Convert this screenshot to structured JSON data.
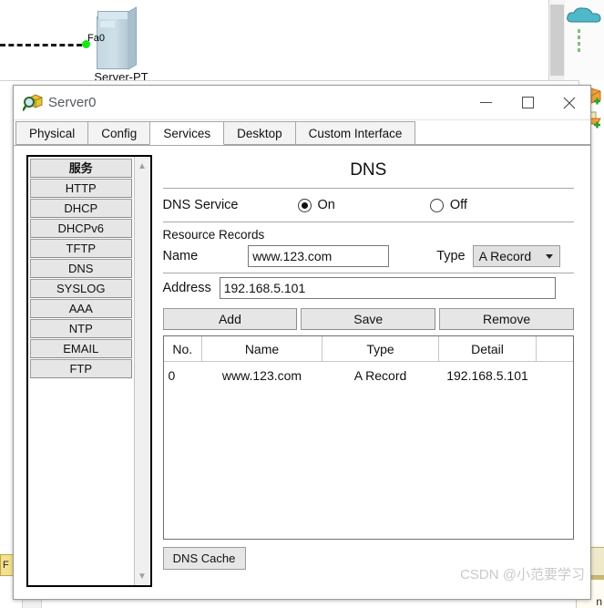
{
  "workspace": {
    "device_port_label": "Fa0",
    "device_name": "Server-PT"
  },
  "dialog": {
    "title": "Server0",
    "icon": "magnifier-package-icon",
    "window_buttons": {
      "minimize": "minimize-icon",
      "maximize": "maximize-icon",
      "close": "close-icon"
    },
    "tabs": [
      {
        "label": "Physical",
        "active": false
      },
      {
        "label": "Config",
        "active": false
      },
      {
        "label": "Services",
        "active": true
      },
      {
        "label": "Desktop",
        "active": false
      },
      {
        "label": "Custom Interface",
        "active": false
      }
    ]
  },
  "services_list": {
    "header": "服务",
    "items": [
      "HTTP",
      "DHCP",
      "DHCPv6",
      "TFTP",
      "DNS",
      "SYSLOG",
      "AAA",
      "NTP",
      "EMAIL",
      "FTP"
    ],
    "scroll_up": "chevron-up-icon",
    "scroll_down": "chevron-down-icon"
  },
  "dns_panel": {
    "title": "DNS",
    "service_label": "DNS Service",
    "radio_on": "On",
    "radio_off": "Off",
    "service_state": "On",
    "resource_records_label": "Resource Records",
    "name_label": "Name",
    "name_value": "www.123.com",
    "name_placeholder": "",
    "type_label": "Type",
    "type_value": "A Record",
    "address_label": "Address",
    "address_value": "192.168.5.101",
    "address_placeholder": "",
    "buttons": {
      "add": "Add",
      "save": "Save",
      "remove": "Remove",
      "dns_cache": "DNS Cache"
    },
    "table": {
      "columns": [
        "No.",
        "Name",
        "Type",
        "Detail",
        ""
      ],
      "rows": [
        {
          "no": "0",
          "name": "www.123.com",
          "type": "A Record",
          "detail": "192.168.5.101"
        }
      ]
    }
  },
  "watermark": "CSDN @小范要学习",
  "left_tab_text": "F"
}
